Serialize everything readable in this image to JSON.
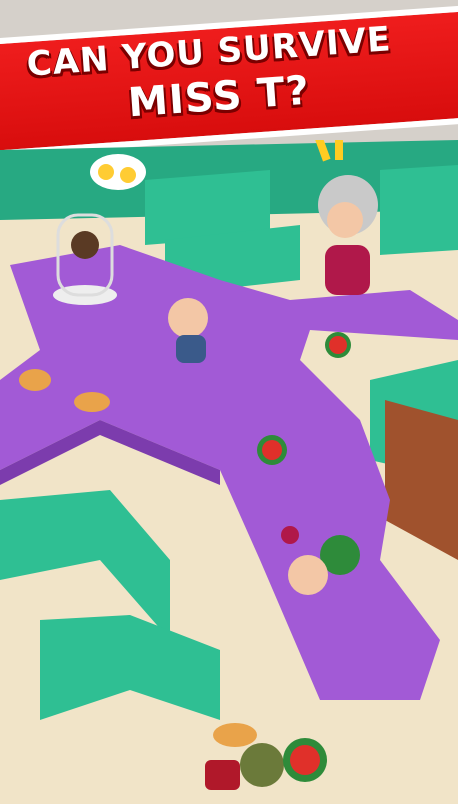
{
  "banner": {
    "line1": "CAN YOU SURVIVE",
    "line2": "MISS T?"
  },
  "colors": {
    "banner": "#e21414",
    "floor": "#f1e4c8",
    "wall": "#2fbf93",
    "path": "#a25ad6"
  },
  "characters": [
    "miss-t",
    "caged-prisoner",
    "bald-man",
    "fallen-soldier",
    "knocked-out-man"
  ],
  "icons": [
    "worried-emoji-speech-bubble",
    "exclamation-marks",
    "watermelon",
    "pie"
  ]
}
